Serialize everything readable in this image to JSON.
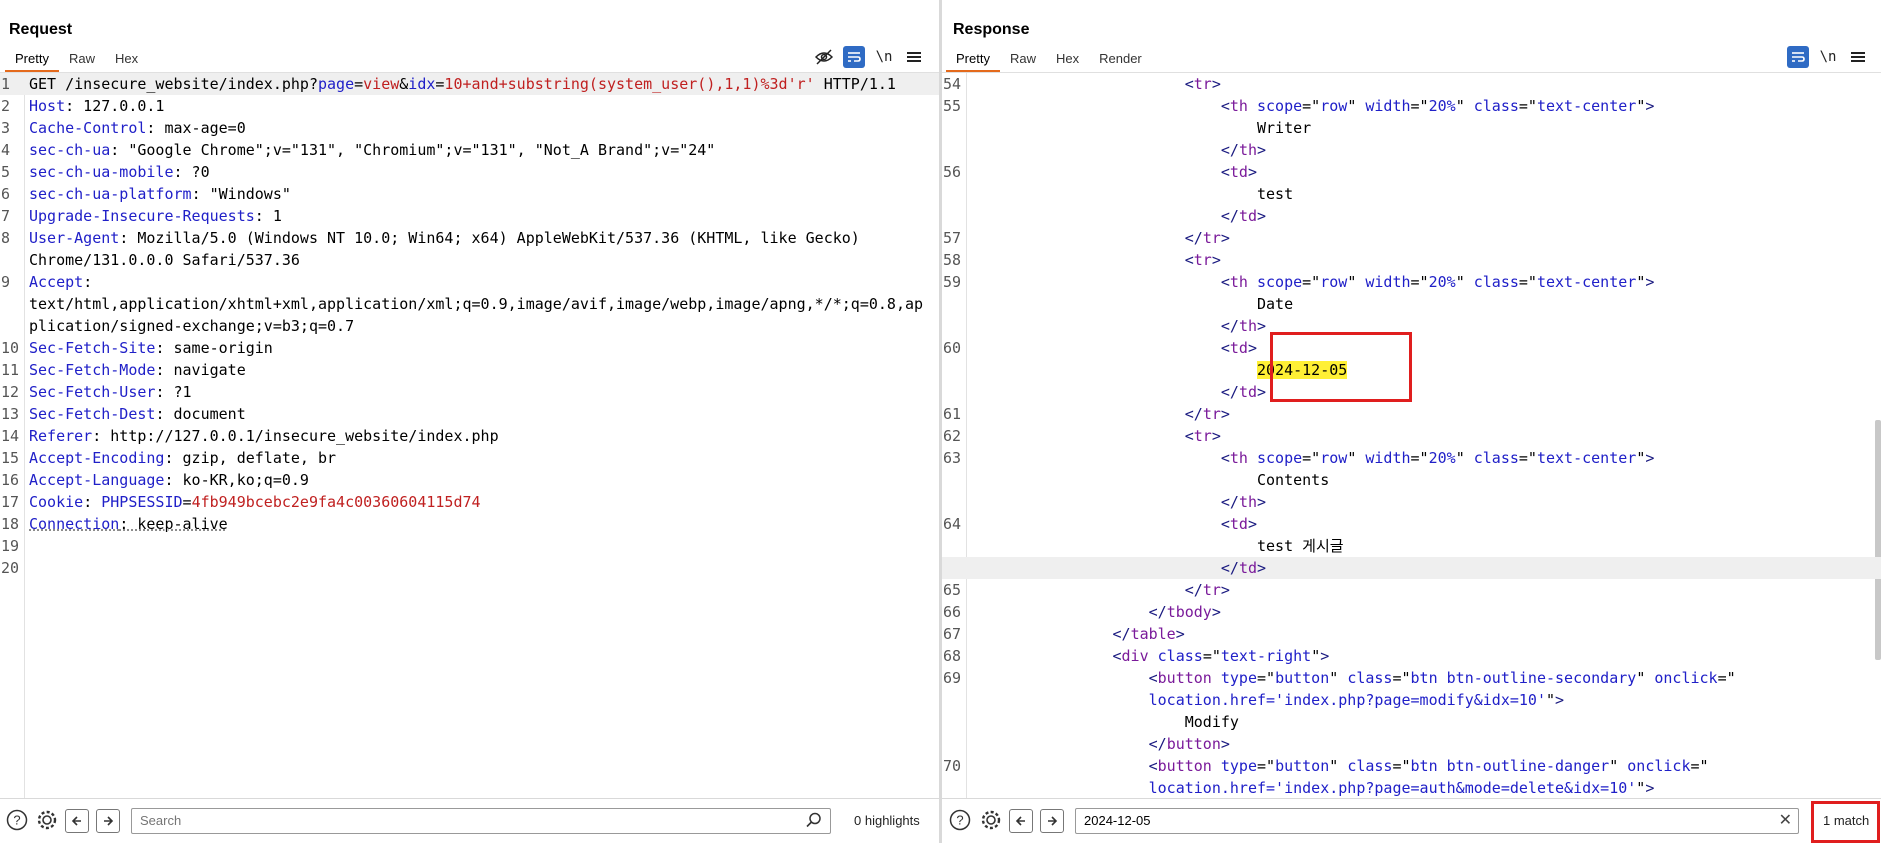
{
  "request": {
    "title": "Request",
    "tabs": [
      "Pretty",
      "Raw",
      "Hex"
    ],
    "search_placeholder": "Search",
    "highlights_label": "0 highlights"
  },
  "response": {
    "title": "Response",
    "tabs": [
      "Pretty",
      "Raw",
      "Hex",
      "Render"
    ],
    "search_value": "2024-12-05",
    "match_label": "1 match"
  },
  "icons": {
    "help": "help-icon",
    "settings": "gear-icon",
    "prev": "arrow-left-icon",
    "next": "arrow-right-icon"
  },
  "colors": {
    "accent": "#2f6bc4",
    "tab_underline": "#e46a1c",
    "highlight": "#fff035",
    "annotation": "#e01e1e"
  }
}
